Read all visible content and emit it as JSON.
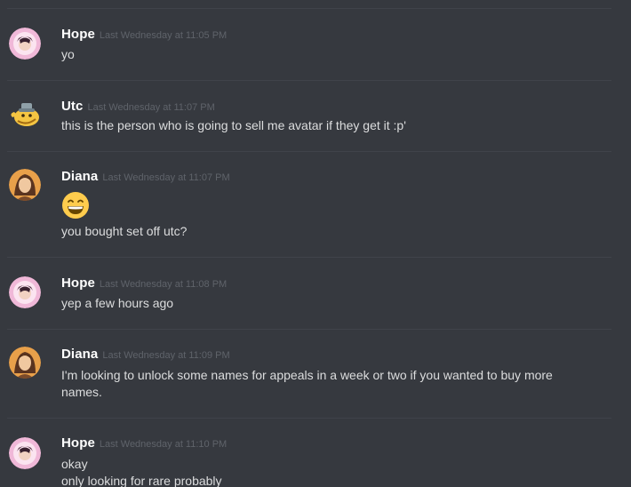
{
  "messages": [
    {
      "author": "Hope",
      "timestamp": "Last Wednesday at 11:05 PM",
      "lines": [
        "yo"
      ]
    },
    {
      "author": "Utc",
      "timestamp": "Last Wednesday at 11:07 PM",
      "lines": [
        "this is the person who is going to sell me avatar if they get it :p'"
      ]
    },
    {
      "author": "Diana",
      "timestamp": "Last Wednesday at 11:07 PM",
      "emoji": "grinning-face",
      "lines": [
        "you bought set off utc?"
      ]
    },
    {
      "author": "Hope",
      "timestamp": "Last Wednesday at 11:08 PM",
      "lines": [
        "yep a few hours ago"
      ]
    },
    {
      "author": "Diana",
      "timestamp": "Last Wednesday at 11:09 PM",
      "lines": [
        "I'm looking to unlock some names for appeals in a week or two if you wanted to buy more names."
      ]
    },
    {
      "author": "Hope",
      "timestamp": "Last Wednesday at 11:10 PM",
      "lines": [
        "okay",
        "only looking for rare probably"
      ]
    }
  ],
  "colors": {
    "background": "#36393f",
    "divider": "#40434a",
    "username": "#ffffff",
    "timestamp": "#5f636a",
    "message_text": "#dcddde",
    "hope_avatar": "#f0b8d8",
    "diana_avatar": "#e8a04a",
    "utc_avatar": "#f5c542"
  }
}
